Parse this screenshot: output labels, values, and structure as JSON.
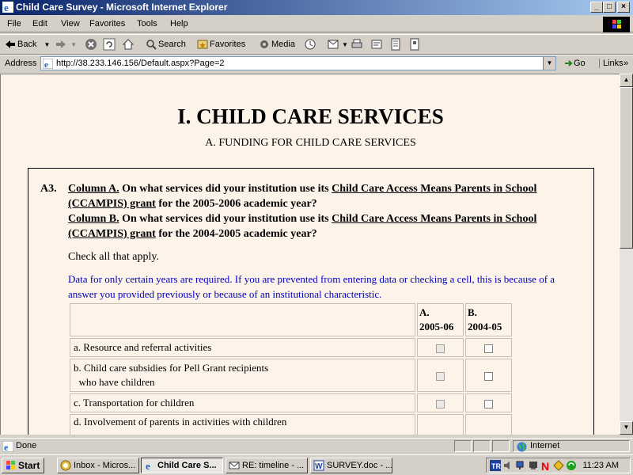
{
  "window": {
    "title": "Child Care Survey - Microsoft Internet Explorer",
    "buttons": {
      "minimize": "_",
      "maximize": "□",
      "close": "×"
    }
  },
  "menu": [
    "File",
    "Edit",
    "View",
    "Favorites",
    "Tools",
    "Help"
  ],
  "toolbar": {
    "back": "Back",
    "search": "Search",
    "favorites": "Favorites",
    "media": "Media"
  },
  "address": {
    "label": "Address",
    "url": "http://38.233.146.156/Default.aspx?Page=2",
    "go": "Go",
    "links": "Links"
  },
  "page": {
    "title": "I. CHILD CARE SERVICES",
    "subtitle": "A. FUNDING FOR CHILD CARE SERVICES",
    "question": {
      "number": "A3.",
      "colA_label": "Column A.",
      "colA_text1": "On what services did your institution use its",
      "grant": "Child Care Access Means Parents in School (CCAMPIS) grant",
      "colA_text2": "for the 2005-2006 academic year?",
      "colB_label": "Column B.",
      "colB_text1": "On what services did your institution use its",
      "colB_text2": "for the 2004-2005 academic year?",
      "instruction": "Check all that apply.",
      "note": "Data for only certain years are required. If you are prevented from entering data or checking a cell, this is because of a answer you provided previously or because of an institutional characteristic."
    },
    "table": {
      "col_a_line1": "A.",
      "col_a_line2": "2005-06",
      "col_b_line1": "B.",
      "col_b_line2": "2004-05",
      "rows": [
        {
          "label": "a. Resource and referral activities",
          "a_enabled": false,
          "b_enabled": true
        },
        {
          "label_line1": "b. Child care subsidies for Pell Grant recipients",
          "label_line2": "who have children",
          "a_enabled": false,
          "b_enabled": true
        },
        {
          "label": "c. Transportation for children",
          "a_enabled": false,
          "b_enabled": true
        },
        {
          "label_line1": "d. Involvement of parents in activities with children",
          "a_enabled": false,
          "b_enabled": true
        }
      ]
    }
  },
  "status": {
    "text": "Done",
    "zone": "Internet"
  },
  "taskbar": {
    "start": "Start",
    "tasks": [
      "Inbox - Micros...",
      "Child Care S...",
      "RE: timeline - ...",
      "SURVEY.doc - ..."
    ],
    "active_index": 1,
    "clock": "11:23 AM"
  }
}
